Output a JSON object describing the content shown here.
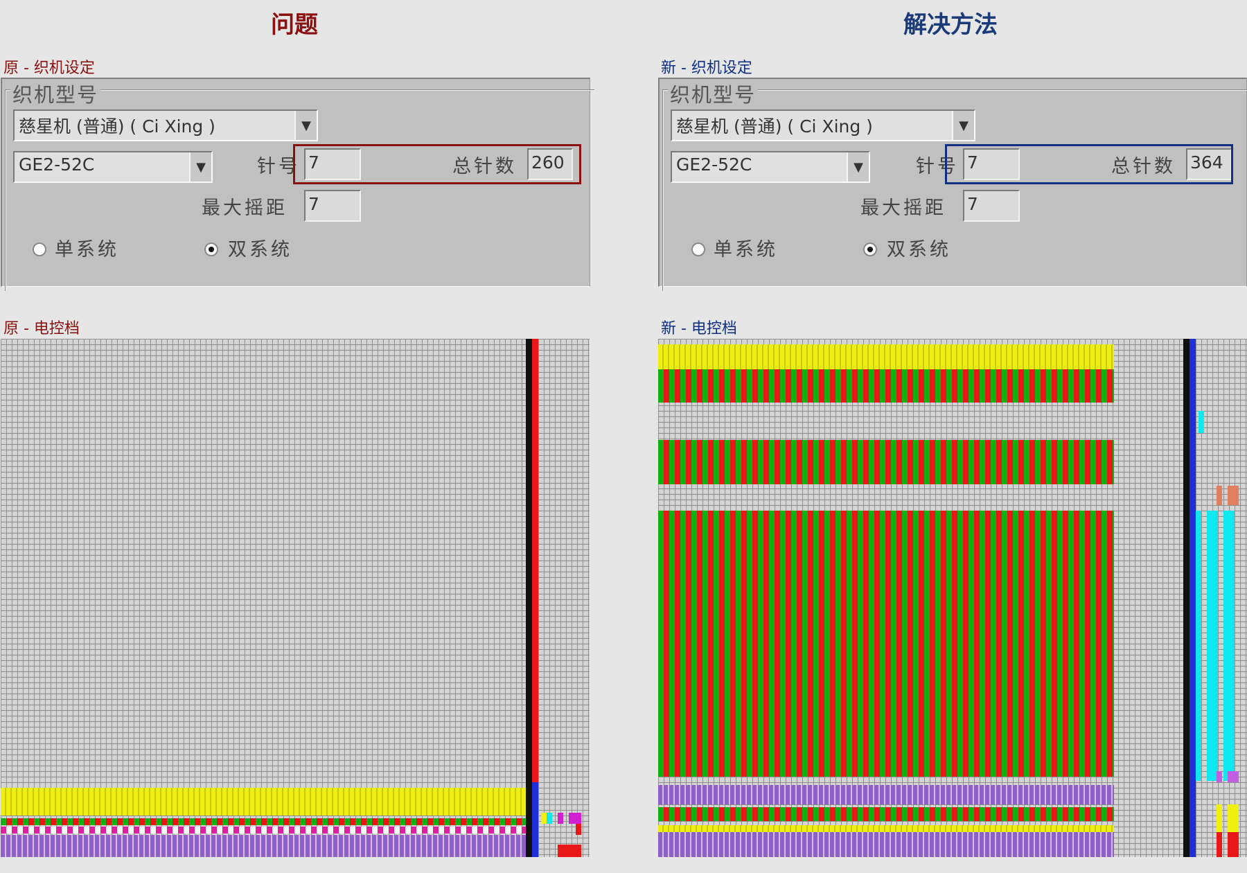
{
  "headings": {
    "problem": "问题",
    "solution": "解决方法"
  },
  "left": {
    "machine_label": "原 - 织机设定",
    "file_label": "原 - 电控档",
    "group_title": "织机型号",
    "machine_type": "慈星机 (普通) ( Ci Xing )",
    "model": "GE2-52C",
    "gauge_label": "针号",
    "gauge_value": "7",
    "total_needles_label": "总针数",
    "total_needles_value": "260",
    "max_racking_label": "最大摇距",
    "max_racking_value": "7",
    "single_system_label": "单系统",
    "dual_system_label": "双系统",
    "selected_system": "dual",
    "highlight_color": "#8b1010"
  },
  "right": {
    "machine_label": "新 - 织机设定",
    "file_label": "新 - 电控档",
    "group_title": "织机型号",
    "machine_type": "慈星机 (普通) ( Ci Xing )",
    "model": "GE2-52C",
    "gauge_label": "针号",
    "gauge_value": "7",
    "total_needles_label": "总针数",
    "total_needles_value": "364",
    "max_racking_label": "最大摇距",
    "max_racking_value": "7",
    "single_system_label": "单系统",
    "dual_system_label": "双系统",
    "selected_system": "dual",
    "highlight_color": "#102f80"
  },
  "colors": {
    "problem_heading": "#8b1010",
    "solution_heading": "#1a3a78",
    "panel_bg": "#c0c0c0",
    "grid_bg": "#d4d4d4",
    "knit_green": "#10b010",
    "knit_red": "#e81818",
    "knit_yellow": "#eeee10",
    "knit_purple": "#9060c8",
    "knit_pink": "#e020a0",
    "color_bar_cyan": "#10e8f0"
  }
}
